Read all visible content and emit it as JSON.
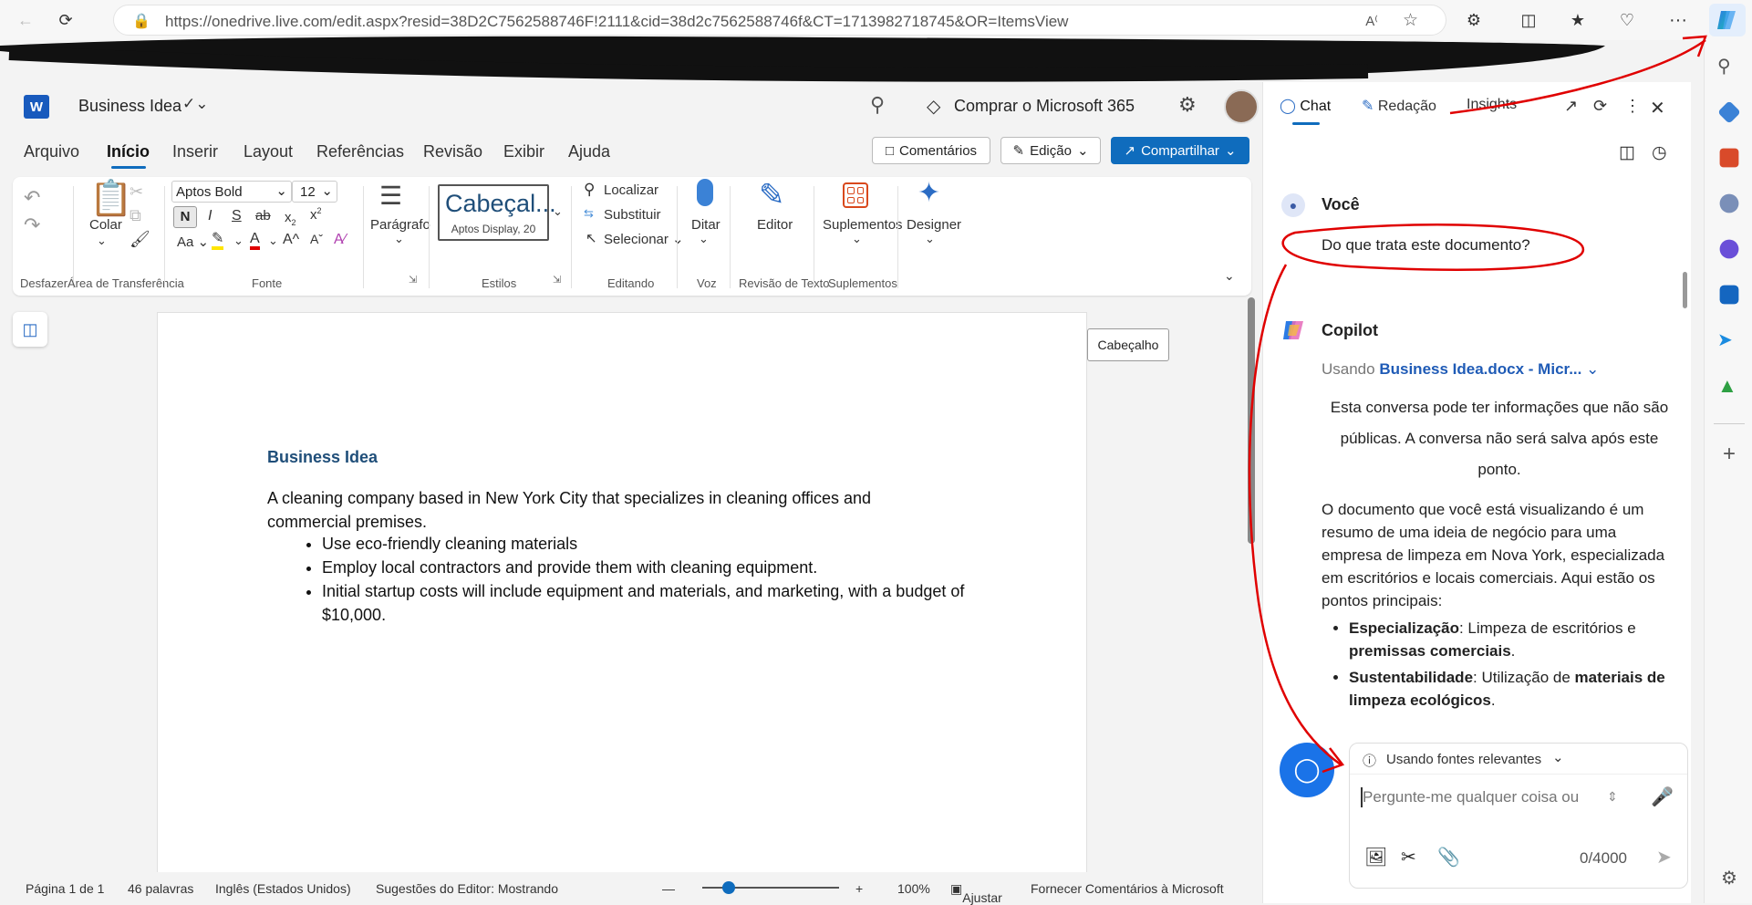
{
  "browser": {
    "url": "https://onedrive.live.com/edit.aspx?resid=38D2C7562588746F!2111&cid=38d2c7562588746f&CT=1713982718745&OR=ItemsView",
    "more_label": "···"
  },
  "word": {
    "doc_name": "Business Idea",
    "buy_label": "Comprar o Microsoft 365",
    "tabs": [
      "Arquivo",
      "Início",
      "Inserir",
      "Layout",
      "Referências",
      "Revisão",
      "Exibir",
      "Ajuda"
    ],
    "comments_btn": "Comentários",
    "edit_btn": "Edição",
    "share_btn": "Compartilhar",
    "ribbon": {
      "undo_group": "Desfazer",
      "paste_label": "Colar",
      "clipboard_group": "Área de Transferência",
      "font_name": "Aptos Bold",
      "font_size": "12",
      "bold": "N",
      "italic": "I",
      "underline": "S",
      "strike": "ab",
      "sub": "x",
      "sup": "x",
      "case": "Aa",
      "grow": "A",
      "shrink": "A",
      "font_group": "Fonte",
      "paragraph_label": "Parágrafo",
      "style_name": "Cabeçal...",
      "style_sub": "Aptos Display, 20",
      "styles_group": "Estilos",
      "find": "Localizar",
      "replace": "Substituir",
      "select": "Selecionar",
      "editing_group": "Editando",
      "dictate": "Ditar",
      "voice_group": "Voz",
      "editor": "Editor",
      "review_group": "Revisão de Texto",
      "addins": "Suplementos",
      "addins_group": "Suplementos",
      "designer": "Designer"
    },
    "header_tag": "Cabeçalho",
    "document": {
      "title": "Business Idea",
      "paragraph": "A cleaning company based in New York City that specializes in cleaning offices and commercial premises.",
      "bullets": [
        "Use eco-friendly cleaning materials",
        "Employ local contractors and provide them with cleaning equipment.",
        "Initial startup costs will include equipment and materials, and marketing, with a budget of $10,000."
      ]
    },
    "status": {
      "page": "Página 1 de 1",
      "words": "46 palavras",
      "lang": "Inglês (Estados Unidos)",
      "editor": "Sugestões do Editor: Mostrando",
      "zoom_minus": "—",
      "zoom_plus": "+",
      "zoom": "100%",
      "fit": "Ajustar",
      "feedback": "Fornecer Comentários à Microsoft"
    }
  },
  "copilot": {
    "tabs": [
      "Chat",
      "Redação",
      "Insights"
    ],
    "you_label": "Você",
    "user_message": "Do que trata este documento?",
    "copilot_label": "Copilot",
    "using_prefix": "Usando",
    "using_doc": "Business Idea.docx - Micr...",
    "privacy_note": "Esta conversa pode ter informações que não são públicas. A conversa não será salva após este ponto.",
    "answer_intro": "O documento que você está visualizando é um resumo de uma ideia de negócio para uma empresa de limpeza em Nova York, especializada em escritórios e locais comerciais. Aqui estão os pontos principais:",
    "points": [
      {
        "key": "Especialização",
        "text_a": ": Limpeza de escritórios e ",
        "bold_b": "premissas comerciais",
        "text_c": "."
      },
      {
        "key": "Sustentabilidade",
        "text_a": ": Utilização de ",
        "bold_b": "materiais de limpeza ecológicos",
        "text_c": "."
      }
    ],
    "sources_label": "Usando fontes relevantes",
    "input_placeholder": "Pergunte-me qualquer coisa ou",
    "char_count": "0/4000"
  },
  "colors": {
    "accent": "#0f6cbd",
    "copilot_fab": "#1a73e8",
    "annotation": "#e00000",
    "doc_title": "#1f4e79"
  }
}
